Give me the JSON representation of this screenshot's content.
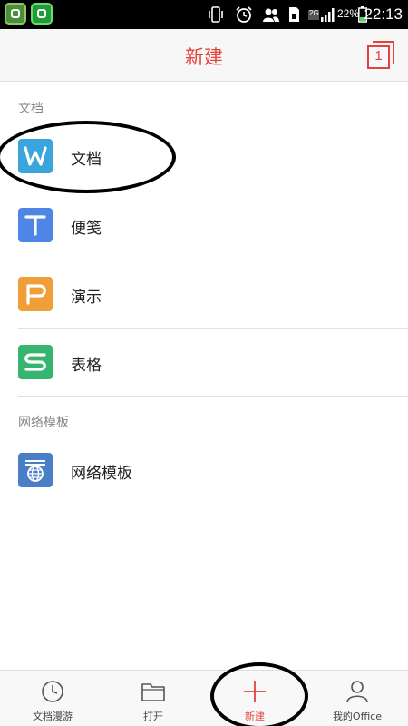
{
  "status_bar": {
    "network": "2G",
    "battery": "22%",
    "time": "22:13"
  },
  "header": {
    "title": "新建",
    "tab_count": "1"
  },
  "sections": [
    {
      "label": "文档",
      "items": [
        {
          "label": "文档",
          "icon": "wps-writer-icon",
          "color": "#3aa5dc",
          "letter": "W"
        },
        {
          "label": "便笺",
          "icon": "note-icon",
          "color": "#4f86e6",
          "letter": "T"
        },
        {
          "label": "演示",
          "icon": "presentation-icon",
          "color": "#f09e38",
          "letter": "P"
        },
        {
          "label": "表格",
          "icon": "spreadsheet-icon",
          "color": "#35b56f",
          "letter": "S"
        }
      ]
    },
    {
      "label": "网络模板",
      "items": [
        {
          "label": "网络模板",
          "icon": "web-template-icon",
          "color": "#4a7fc8"
        }
      ]
    }
  ],
  "bottom_nav": {
    "items": [
      {
        "label": "文档漫游",
        "icon": "clock-icon"
      },
      {
        "label": "打开",
        "icon": "folder-icon"
      },
      {
        "label": "新建",
        "icon": "plus-icon",
        "active": true
      },
      {
        "label": "我的Office",
        "icon": "user-icon"
      }
    ]
  },
  "accent_color": "#e4423c"
}
